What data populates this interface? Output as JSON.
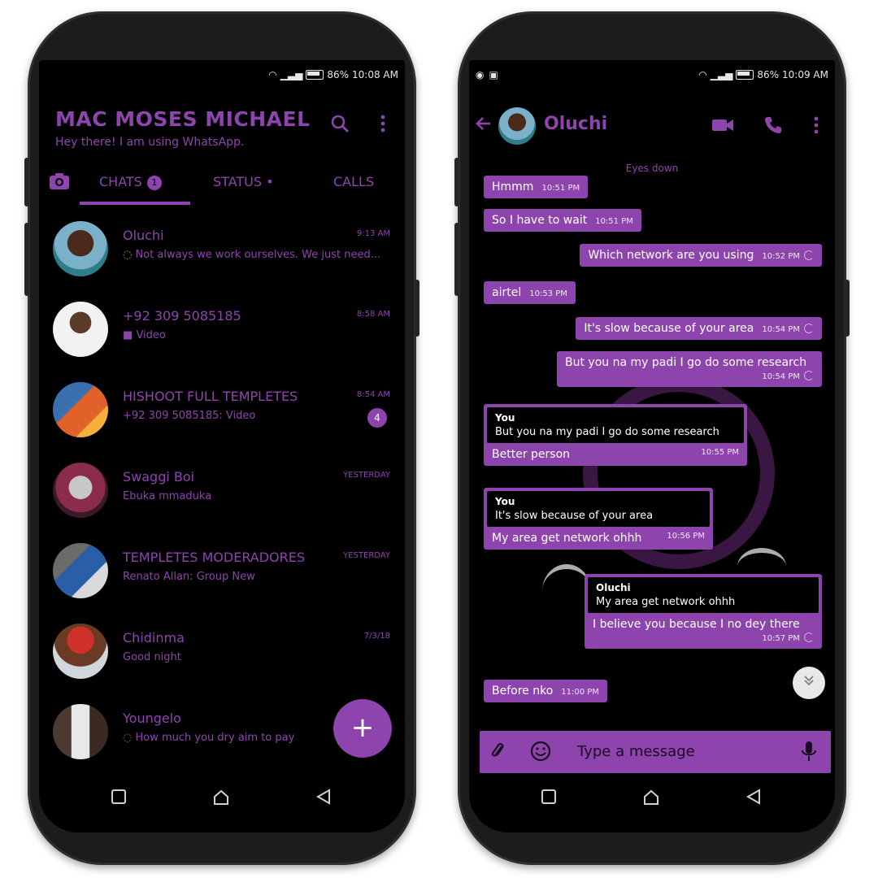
{
  "left_phone": {
    "status": {
      "battery": "86%",
      "time": "10:08 AM"
    },
    "header": {
      "title": "MAC MOSES MICHAEL",
      "subtitle": "Hey there! I am using WhatsApp."
    },
    "icons": {
      "search": "search-icon",
      "menu": "more-vert-icon",
      "camera": "camera-icon"
    },
    "tabs": [
      {
        "label": "CHATS",
        "badge": "1"
      },
      {
        "label": "STATUS",
        "dot": "•"
      },
      {
        "label": "CALLS"
      }
    ],
    "chats": [
      {
        "name": "Oluchi",
        "time": "9:13 AM",
        "preview": "Not always we work ourselves. We just need..."
      },
      {
        "name": "+92 309 5085185",
        "time": "8:58 AM",
        "preview": "Video"
      },
      {
        "name": "HISHOOT FULL TEMPLETES",
        "time": "8:54 AM",
        "preview": "+92 309 5085185: Video",
        "unread": "4"
      },
      {
        "name": "Swaggi Boi",
        "time": "YESTERDAY",
        "preview": "Ebuka mmaduka"
      },
      {
        "name": "TEMPLETES MODERADORES",
        "time": "YESTERDAY",
        "preview": "Renato Allan: Group New"
      },
      {
        "name": "Chidinma",
        "time": "7/3/18",
        "preview": "Good night"
      },
      {
        "name": "Youngelo",
        "time": "",
        "preview": "How much you dry aim to pay"
      }
    ],
    "fab": "+"
  },
  "right_phone": {
    "status": {
      "battery": "86%",
      "time": "10:09 AM"
    },
    "contact": {
      "name": "Oluchi"
    },
    "date_chip": "Eyes down",
    "messages": [
      {
        "text": "Hmmm",
        "time": "10:51 PM"
      },
      {
        "text": "So I have to wait",
        "time": "10:51 PM"
      },
      {
        "text": "Which network are you using",
        "time": "10:52 PM"
      },
      {
        "text": "airtel",
        "time": "10:53 PM"
      },
      {
        "text": "It's slow because of your area",
        "time": "10:54 PM"
      },
      {
        "text": "But you na my padi I go do some research",
        "time": "10:54 PM"
      },
      {
        "quote_author": "You",
        "quote_text": "But you na my padi I go do some research",
        "text": "Better person",
        "time": "10:55 PM"
      },
      {
        "quote_author": "You",
        "quote_text": "It's slow because of your area",
        "text": "My area get network ohhh",
        "time": "10:56 PM"
      },
      {
        "quote_author": "Oluchi",
        "quote_text": "My area get network ohhh",
        "text": "I believe you because I no dey there",
        "time": "10:57 PM"
      },
      {
        "text": "Before nko",
        "time": "11:00 PM"
      }
    ],
    "input_placeholder": "Type a message"
  },
  "colors": {
    "accent": "#8e44ad",
    "background": "#000000"
  }
}
